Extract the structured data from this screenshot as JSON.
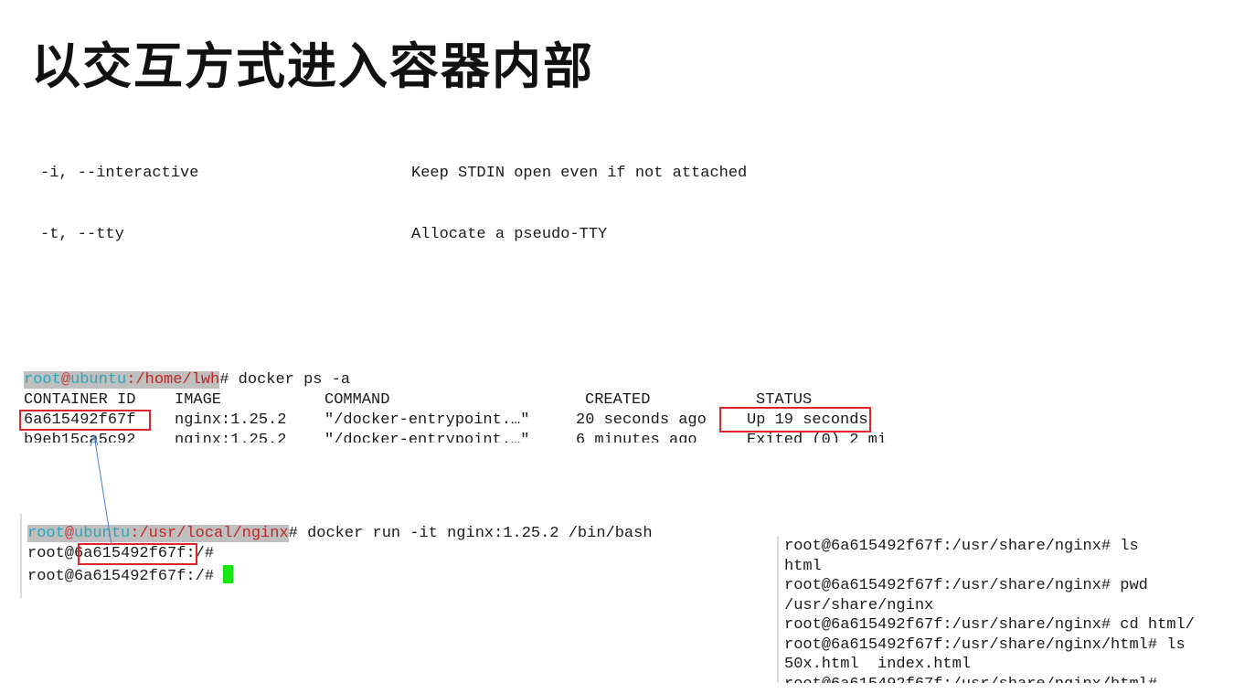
{
  "slide": {
    "title": "以交互方式进入容器内部"
  },
  "options": [
    {
      "flag": "-i, --interactive",
      "desc": "Keep STDIN open even if not attached"
    },
    {
      "flag": "-t, --tty",
      "desc": "Allocate a pseudo-TTY"
    }
  ],
  "ps_panel": {
    "prompt_user": "root",
    "prompt_at": "@",
    "prompt_host": "ubuntu",
    "prompt_path": ":/home/lwh",
    "prompt_suffix": "# docker ps -a",
    "headers": [
      "CONTAINER ID",
      "IMAGE",
      "COMMAND",
      "CREATED",
      "STATUS"
    ],
    "row1": [
      "6a615492f67f",
      "nginx:1.25.2",
      "\"/docker-entrypoint.…\"",
      "20 seconds ago",
      "Up 19 seconds"
    ],
    "row2": [
      "b9eb15ca5c92",
      "nginx:1.25.2",
      "\"/docker-entrypoint.…\"",
      "6 minutes ago",
      "Exited (0) 2 mi"
    ]
  },
  "run_panel": {
    "prompt_user": "root",
    "prompt_at": "@",
    "prompt_host": "ubuntu",
    "prompt_path": ":/usr/local/nginx",
    "cmd_suffix": "# docker run -it nginx:1.25.2 /bin/bash",
    "line2_prefix": "root@",
    "line2_id": "6a615492f67f",
    "line2_suffix": ":/#",
    "line3": "root@6a615492f67f:/# "
  },
  "ls_panel": {
    "lines": [
      "root@6a615492f67f:/usr/share/nginx# ls",
      "html",
      "root@6a615492f67f:/usr/share/nginx# pwd",
      "/usr/share/nginx",
      "root@6a615492f67f:/usr/share/nginx# cd html/",
      "root@6a615492f67f:/usr/share/nginx/html# ls",
      "50x.html  index.html",
      "root@6a615492f67f:/usr/share/nginx/html#"
    ]
  },
  "colors": {
    "highlight_box": "#e0242b",
    "cursor": "#16e516",
    "prompt_user": "#2aa7b8",
    "prompt_path": "#c02626"
  }
}
